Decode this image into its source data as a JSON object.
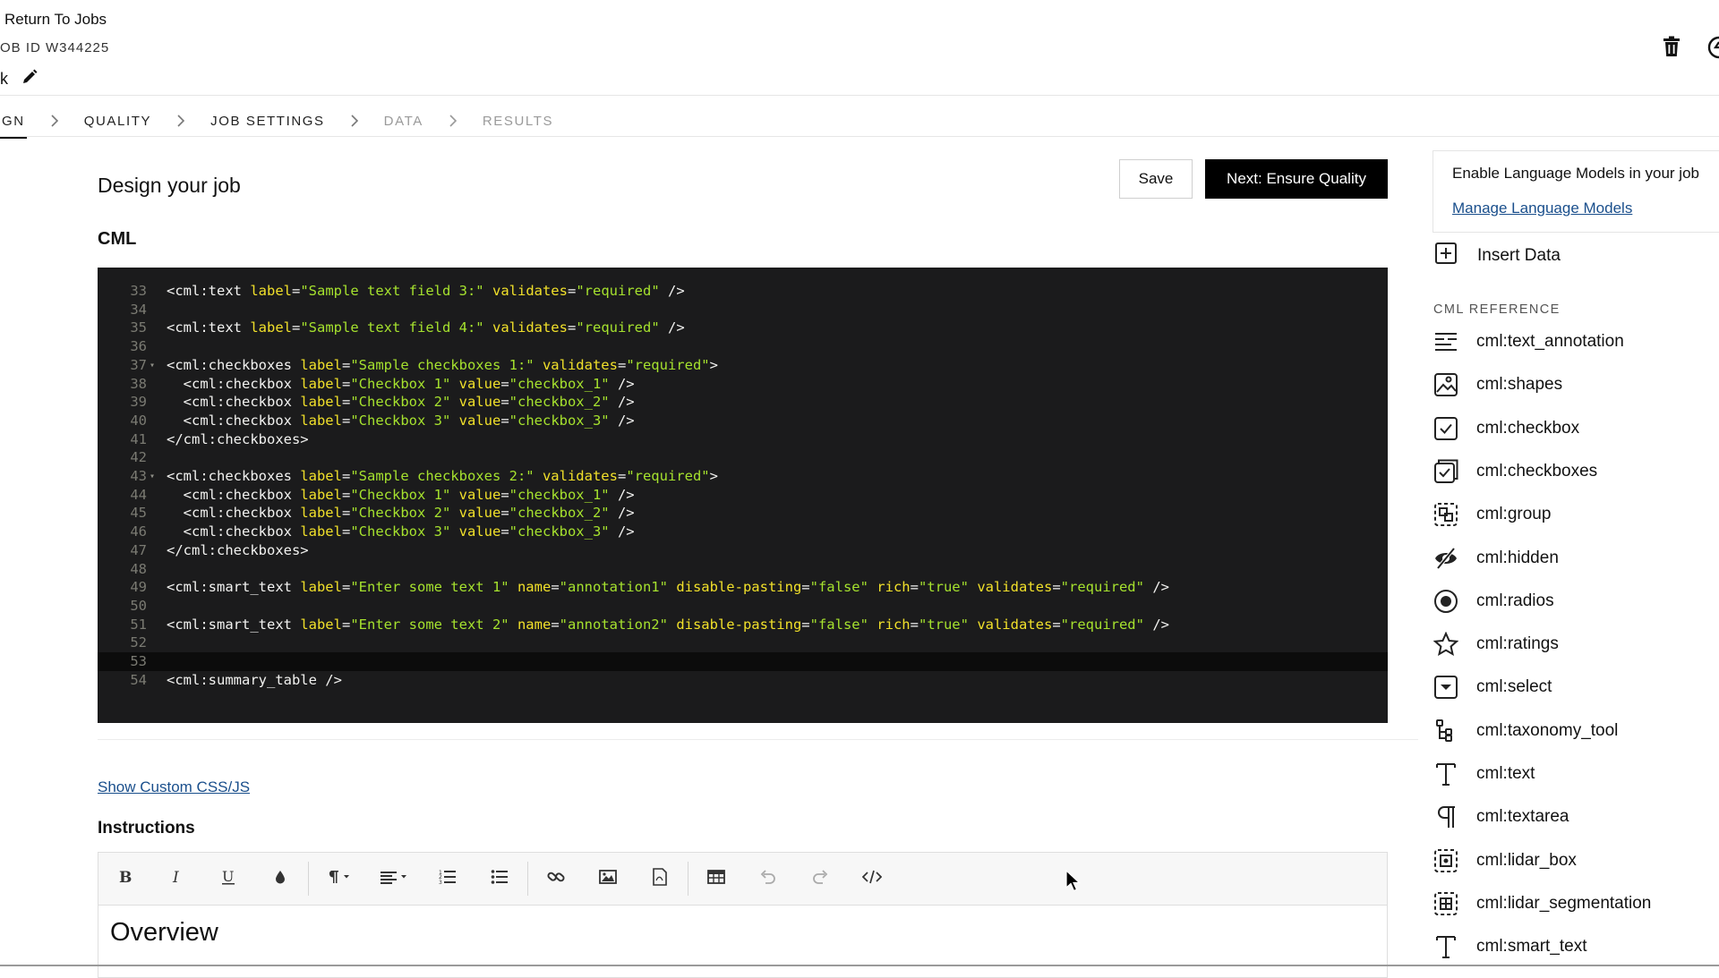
{
  "header": {
    "return_label": "Return To Jobs",
    "job_id": "OB ID W344225",
    "title_fragment": "k"
  },
  "breadcrumb": [
    {
      "label": "GN",
      "state": "active"
    },
    {
      "label": "QUALITY",
      "state": "enabled"
    },
    {
      "label": "JOB SETTINGS",
      "state": "enabled"
    },
    {
      "label": "DATA",
      "state": "disabled"
    },
    {
      "label": "RESULTS",
      "state": "disabled"
    }
  ],
  "main": {
    "title": "Design your job",
    "save_label": "Save",
    "next_label": "Next: Ensure Quality",
    "cml_heading": "CML",
    "custom_css_link": "Show Custom CSS/JS",
    "instructions_heading": "Instructions",
    "overview_heading": "Overview"
  },
  "code_editor": {
    "current_line": 53,
    "lines": [
      {
        "n": 33,
        "fold": false,
        "tokens": [
          [
            "tag",
            "<cml:text "
          ],
          [
            "attr",
            "label"
          ],
          [
            "punc",
            "="
          ],
          [
            "str",
            "\"Sample text field 3:\""
          ],
          [
            "attr",
            " validates"
          ],
          [
            "punc",
            "="
          ],
          [
            "str",
            "\"required\""
          ],
          [
            "tag",
            " />"
          ]
        ]
      },
      {
        "n": 34,
        "fold": false,
        "tokens": []
      },
      {
        "n": 35,
        "fold": false,
        "tokens": [
          [
            "tag",
            "<cml:text "
          ],
          [
            "attr",
            "label"
          ],
          [
            "punc",
            "="
          ],
          [
            "str",
            "\"Sample text field 4:\""
          ],
          [
            "attr",
            " validates"
          ],
          [
            "punc",
            "="
          ],
          [
            "str",
            "\"required\""
          ],
          [
            "tag",
            " />"
          ]
        ]
      },
      {
        "n": 36,
        "fold": false,
        "tokens": []
      },
      {
        "n": 37,
        "fold": true,
        "tokens": [
          [
            "tag",
            "<cml:checkboxes "
          ],
          [
            "attr",
            "label"
          ],
          [
            "punc",
            "="
          ],
          [
            "str",
            "\"Sample checkboxes 1:\""
          ],
          [
            "attr",
            " validates"
          ],
          [
            "punc",
            "="
          ],
          [
            "str",
            "\"required\""
          ],
          [
            "tag",
            ">"
          ]
        ]
      },
      {
        "n": 38,
        "fold": false,
        "tokens": [
          [
            "tag",
            "  <cml:checkbox "
          ],
          [
            "attr",
            "label"
          ],
          [
            "punc",
            "="
          ],
          [
            "str",
            "\"Checkbox 1\""
          ],
          [
            "attr",
            " value"
          ],
          [
            "punc",
            "="
          ],
          [
            "str",
            "\"checkbox_1\""
          ],
          [
            "tag",
            " />"
          ]
        ]
      },
      {
        "n": 39,
        "fold": false,
        "tokens": [
          [
            "tag",
            "  <cml:checkbox "
          ],
          [
            "attr",
            "label"
          ],
          [
            "punc",
            "="
          ],
          [
            "str",
            "\"Checkbox 2\""
          ],
          [
            "attr",
            " value"
          ],
          [
            "punc",
            "="
          ],
          [
            "str",
            "\"checkbox_2\""
          ],
          [
            "tag",
            " />"
          ]
        ]
      },
      {
        "n": 40,
        "fold": false,
        "tokens": [
          [
            "tag",
            "  <cml:checkbox "
          ],
          [
            "attr",
            "label"
          ],
          [
            "punc",
            "="
          ],
          [
            "str",
            "\"Checkbox 3\""
          ],
          [
            "attr",
            " value"
          ],
          [
            "punc",
            "="
          ],
          [
            "str",
            "\"checkbox_3\""
          ],
          [
            "tag",
            " />"
          ]
        ]
      },
      {
        "n": 41,
        "fold": false,
        "tokens": [
          [
            "tag",
            "</cml:checkboxes>"
          ]
        ]
      },
      {
        "n": 42,
        "fold": false,
        "tokens": []
      },
      {
        "n": 43,
        "fold": true,
        "tokens": [
          [
            "tag",
            "<cml:checkboxes "
          ],
          [
            "attr",
            "label"
          ],
          [
            "punc",
            "="
          ],
          [
            "str",
            "\"Sample checkboxes 2:\""
          ],
          [
            "attr",
            " validates"
          ],
          [
            "punc",
            "="
          ],
          [
            "str",
            "\"required\""
          ],
          [
            "tag",
            ">"
          ]
        ]
      },
      {
        "n": 44,
        "fold": false,
        "tokens": [
          [
            "tag",
            "  <cml:checkbox "
          ],
          [
            "attr",
            "label"
          ],
          [
            "punc",
            "="
          ],
          [
            "str",
            "\"Checkbox 1\""
          ],
          [
            "attr",
            " value"
          ],
          [
            "punc",
            "="
          ],
          [
            "str",
            "\"checkbox_1\""
          ],
          [
            "tag",
            " />"
          ]
        ]
      },
      {
        "n": 45,
        "fold": false,
        "tokens": [
          [
            "tag",
            "  <cml:checkbox "
          ],
          [
            "attr",
            "label"
          ],
          [
            "punc",
            "="
          ],
          [
            "str",
            "\"Checkbox 2\""
          ],
          [
            "attr",
            " value"
          ],
          [
            "punc",
            "="
          ],
          [
            "str",
            "\"checkbox_2\""
          ],
          [
            "tag",
            " />"
          ]
        ]
      },
      {
        "n": 46,
        "fold": false,
        "tokens": [
          [
            "tag",
            "  <cml:checkbox "
          ],
          [
            "attr",
            "label"
          ],
          [
            "punc",
            "="
          ],
          [
            "str",
            "\"Checkbox 3\""
          ],
          [
            "attr",
            " value"
          ],
          [
            "punc",
            "="
          ],
          [
            "str",
            "\"checkbox_3\""
          ],
          [
            "tag",
            " />"
          ]
        ]
      },
      {
        "n": 47,
        "fold": false,
        "tokens": [
          [
            "tag",
            "</cml:checkboxes>"
          ]
        ]
      },
      {
        "n": 48,
        "fold": false,
        "tokens": []
      },
      {
        "n": 49,
        "fold": false,
        "tokens": [
          [
            "tag",
            "<cml:smart_text "
          ],
          [
            "attr",
            "label"
          ],
          [
            "punc",
            "="
          ],
          [
            "str",
            "\"Enter some text 1\""
          ],
          [
            "attr",
            " name"
          ],
          [
            "punc",
            "="
          ],
          [
            "str",
            "\"annotation1\""
          ],
          [
            "attr",
            " disable-pasting"
          ],
          [
            "punc",
            "="
          ],
          [
            "str",
            "\"false\""
          ],
          [
            "attr",
            " rich"
          ],
          [
            "punc",
            "="
          ],
          [
            "str",
            "\"true\""
          ],
          [
            "attr",
            " validates"
          ],
          [
            "punc",
            "="
          ],
          [
            "str",
            "\"required\""
          ],
          [
            "tag",
            " />"
          ]
        ]
      },
      {
        "n": 50,
        "fold": false,
        "tokens": []
      },
      {
        "n": 51,
        "fold": false,
        "tokens": [
          [
            "tag",
            "<cml:smart_text "
          ],
          [
            "attr",
            "label"
          ],
          [
            "punc",
            "="
          ],
          [
            "str",
            "\"Enter some text 2\""
          ],
          [
            "attr",
            " name"
          ],
          [
            "punc",
            "="
          ],
          [
            "str",
            "\"annotation2\""
          ],
          [
            "attr",
            " disable-pasting"
          ],
          [
            "punc",
            "="
          ],
          [
            "str",
            "\"false\""
          ],
          [
            "attr",
            " rich"
          ],
          [
            "punc",
            "="
          ],
          [
            "str",
            "\"true\""
          ],
          [
            "attr",
            " validates"
          ],
          [
            "punc",
            "="
          ],
          [
            "str",
            "\"required\""
          ],
          [
            "tag",
            " />"
          ]
        ]
      },
      {
        "n": 52,
        "fold": false,
        "tokens": []
      },
      {
        "n": 53,
        "fold": false,
        "tokens": []
      },
      {
        "n": 54,
        "fold": false,
        "tokens": [
          [
            "tag",
            "<cml:summary_table />"
          ]
        ]
      }
    ]
  },
  "toolbar": {
    "items": [
      {
        "icon": "bold-icon",
        "title": "Bold"
      },
      {
        "icon": "italic-icon",
        "title": "Italic"
      },
      {
        "icon": "underline-icon",
        "title": "Underline"
      },
      {
        "icon": "text-color-icon",
        "title": "Text color"
      },
      {
        "sep": true
      },
      {
        "icon": "paragraph-format-icon",
        "title": "Paragraph format",
        "dropdown": true
      },
      {
        "icon": "align-icon",
        "title": "Align",
        "dropdown": true
      },
      {
        "icon": "ordered-list-icon",
        "title": "Ordered list"
      },
      {
        "icon": "unordered-list-icon",
        "title": "Unordered list"
      },
      {
        "sep": true
      },
      {
        "icon": "link-icon",
        "title": "Insert link"
      },
      {
        "icon": "image-icon",
        "title": "Insert image"
      },
      {
        "icon": "pdf-icon",
        "title": "Insert PDF"
      },
      {
        "sep": true
      },
      {
        "icon": "table-icon",
        "title": "Insert table"
      },
      {
        "icon": "undo-icon",
        "title": "Undo"
      },
      {
        "icon": "redo-icon",
        "title": "Redo"
      },
      {
        "icon": "code-view-icon",
        "title": "Code view"
      }
    ]
  },
  "right_panel": {
    "llm_text": "Enable Language Models in your job",
    "llm_link": "Manage Language Models",
    "insert_data_label": "Insert Data",
    "cml_reference_heading": "CML REFERENCE",
    "items": [
      {
        "label": "cml:text_annotation",
        "icon": "text-annotation-icon"
      },
      {
        "label": "cml:shapes",
        "icon": "shapes-image-icon"
      },
      {
        "label": "cml:checkbox",
        "icon": "checkbox-icon"
      },
      {
        "label": "cml:checkboxes",
        "icon": "checkboxes-icon"
      },
      {
        "label": "cml:group",
        "icon": "group-icon"
      },
      {
        "label": "cml:hidden",
        "icon": "hidden-eye-icon"
      },
      {
        "label": "cml:radios",
        "icon": "radio-icon"
      },
      {
        "label": "cml:ratings",
        "icon": "star-icon"
      },
      {
        "label": "cml:select",
        "icon": "select-dropdown-icon"
      },
      {
        "label": "cml:taxonomy_tool",
        "icon": "taxonomy-tree-icon"
      },
      {
        "label": "cml:text",
        "icon": "text-t-icon"
      },
      {
        "label": "cml:textarea",
        "icon": "pilcrow-icon"
      },
      {
        "label": "cml:lidar_box",
        "icon": "lidar-box-icon"
      },
      {
        "label": "cml:lidar_segmentation",
        "icon": "lidar-segmentation-icon"
      },
      {
        "label": "cml:smart_text",
        "icon": "smart-text-icon"
      }
    ]
  }
}
